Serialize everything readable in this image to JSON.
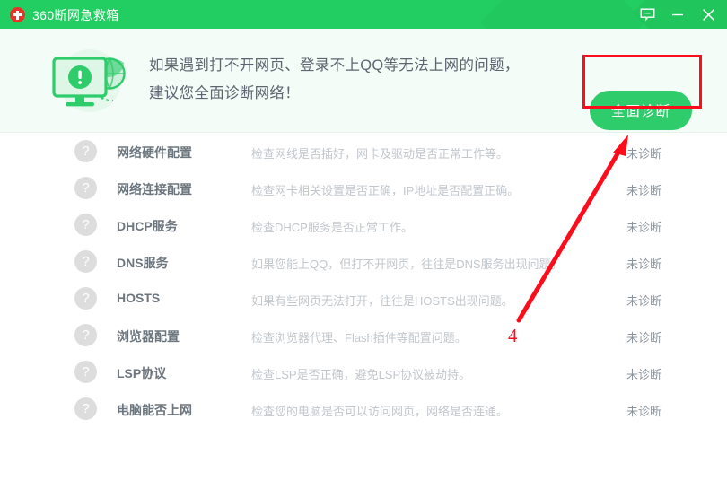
{
  "window": {
    "title": "360断网急救箱",
    "logo_icon": "first-aid-cross-icon",
    "controls": {
      "feedback_icon": "feedback-message-icon",
      "minimize_icon": "minimize-icon",
      "close_icon": "close-icon"
    },
    "accent_green": "#22ce61",
    "button_green": "#2ecc6b",
    "logo_red": "#e8322a"
  },
  "banner": {
    "icon": "monitor-warning-globe-icon",
    "line1": "如果遇到打不开网页、登录不上QQ等无法上网的问题，",
    "line2": "建议您全面诊断网络！",
    "diagnose_button": "全面诊断",
    "background": "#f3fcf7"
  },
  "list": {
    "status_icon": "question-mark-icon",
    "rows": [
      {
        "title": "网络硬件配置",
        "desc": "检查网线是否插好，网卡及驱动是否正常工作等。",
        "status": "未诊断"
      },
      {
        "title": "网络连接配置",
        "desc": "检查网卡相关设置是否正确，IP地址是否配置正确。",
        "status": "未诊断"
      },
      {
        "title": "DHCP服务",
        "desc": "检查DHCP服务是否正常工作。",
        "status": "未诊断"
      },
      {
        "title": "DNS服务",
        "desc": "如果您能上QQ，但打不开网页，往往是DNS服务出现问题。",
        "status": "未诊断"
      },
      {
        "title": "HOSTS",
        "desc": "如果有些网页无法打开，往往是HOSTS出现问题。",
        "status": "未诊断"
      },
      {
        "title": "浏览器配置",
        "desc": "检查浏览器代理、Flash插件等配置问题。",
        "status": "未诊断"
      },
      {
        "title": "LSP协议",
        "desc": "检查LSP是否正确，避免LSP协议被劫持。",
        "status": "未诊断"
      },
      {
        "title": "电脑能否上网",
        "desc": "检查您的电脑是否可以访问网页，网络是否连通。",
        "status": "未诊断"
      }
    ]
  },
  "annotations": {
    "step_number": "4",
    "color": "#fc0d1b"
  }
}
